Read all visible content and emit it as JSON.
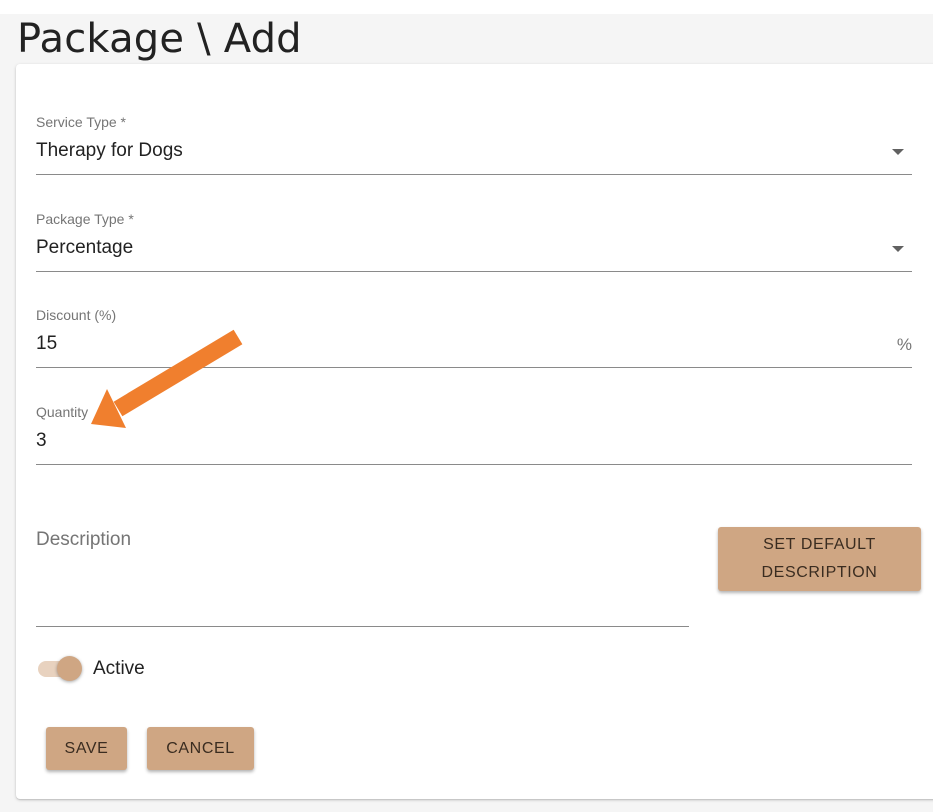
{
  "page": {
    "title": "Package \\ Add"
  },
  "form": {
    "service_type": {
      "label": "Service Type *",
      "value": "Therapy for Dogs"
    },
    "package_type": {
      "label": "Package Type *",
      "value": "Percentage"
    },
    "discount": {
      "label": "Discount (%)",
      "value": "15",
      "suffix": "%"
    },
    "quantity": {
      "label": "Quantity",
      "value": "3"
    },
    "description": {
      "label": "Description",
      "value": ""
    },
    "set_default_description_label_line1": "SET DEFAULT",
    "set_default_description_label_line2": "DESCRIPTION",
    "active": {
      "label": "Active",
      "checked": true
    }
  },
  "actions": {
    "save_label": "SAVE",
    "cancel_label": "CANCEL"
  },
  "annotation": {
    "arrow_color": "#f07f2e",
    "arrow_target": "quantity-field"
  },
  "colors": {
    "accent": "#cfa683",
    "accent_light": "#e8d2bf",
    "button_text": "#3a2c20"
  },
  "icons": {
    "dropdown": "chevron-down-icon"
  }
}
